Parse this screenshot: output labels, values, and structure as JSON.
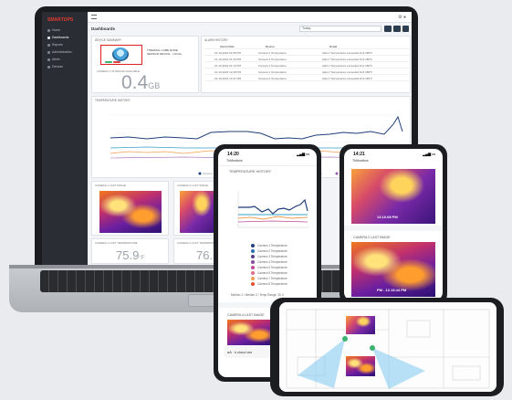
{
  "dashboard": {
    "logo": "SMARTOPS",
    "page_title": "Dashboards",
    "nav_items": [
      "Home",
      "Dashboards",
      "Reports",
      "Administration",
      "Alerts",
      "Devices"
    ],
    "date_range": "Today",
    "device_panel_title": "DEVICE SUMMARY",
    "device_name": "THERMAL CUBE NODE",
    "device_subtitle": "SENSOR DEVICE · LOCAL",
    "storage_label": "CAMERA 1 STORAGE AVAILABLE",
    "storage_value": "0.4",
    "storage_unit": "GB",
    "alarm_panel_title": "ALARM HISTORY",
    "alarm_headers": [
      "Alarm Date",
      "Device",
      "Detail"
    ],
    "alarm_rows": [
      [
        "21-10-2022 01:55 PM",
        "Camera 1 Temperature",
        "Alarm! Temperature exceeded limit 180°F"
      ],
      [
        "21-10-2022 01:34 PM",
        "Camera 2 Temperature",
        "Alarm! Temperature exceeded limit 180°F"
      ],
      [
        "21-10-2022 01:12 PM",
        "Camera 1 Temperature",
        "Alarm! Temperature exceeded limit 180°F"
      ],
      [
        "21-10-2022 12:48 PM",
        "Camera 1 Temperature",
        "Alarm! Temperature exceeded limit 180°F"
      ],
      [
        "21-10-2022 12:21 PM",
        "Camera 2 Temperature",
        "Alarm! Temperature exceeded limit 180°F"
      ]
    ],
    "temp_history_title": "TEMPERATURE HISTORY",
    "temp_legend": [
      "Camera 1 Temperature",
      "Camera 2 Temperature",
      "Camera 3 Temperature",
      "Camera 4 Temperature"
    ],
    "cam1_title": "CAMERA 1 LAST IMAGE",
    "cam2_title": "CAMERA 2 LAST IMAGE",
    "cam1_temp_title": "CAMERA 1 LAST TEMPERATURE",
    "cam2_temp_title": "CAMERA 2 LAST TEMPERATURE",
    "cam1_temp": "75.9",
    "cam1_temp_unit": "°F",
    "cam2_temp": "76."
  },
  "phone1": {
    "time": "14:20",
    "subtitle": "ThMonitors",
    "section": "TEMPERATURE HISTORY",
    "legend": [
      {
        "label": "Camera 1 Temperature",
        "color": "#1f3f7a"
      },
      {
        "label": "Camera 2 Temperature",
        "color": "#2a6fb0"
      },
      {
        "label": "Camera 3 Temperature",
        "color": "#5b3f8c"
      },
      {
        "label": "Camera 4 Temperature",
        "color": "#8a4aa0"
      },
      {
        "label": "Camera 5 Temperature",
        "color": "#c04a9a"
      },
      {
        "label": "Camera 6 Temperature",
        "color": "#e0708a"
      },
      {
        "label": "Camera 7 Temperature",
        "color": "#f0a050"
      },
      {
        "label": "Camera 8 Temperature",
        "color": "#e05030"
      }
    ],
    "range_label": "Median 1 / Median 2 / Temp Range: 30 d",
    "cam_section": "CAMERA 4 LAST IMAGE",
    "nav_back": "aA",
    "nav_label": "ś cloud.mo"
  },
  "phone2": {
    "time": "14:21",
    "subtitle": "ThMonitors",
    "img1_caption": "13.10.08 PM",
    "cam_section": "CAMERA 2 LAST IMAGE",
    "img2_caption": "PM - 12.15.44 PM"
  },
  "colors": {
    "accent_red": "#e02020",
    "sidebar_bg": "#2a2d33",
    "series_blue": "#1f3f7a",
    "series_orange": "#f0a050",
    "series_cyan": "#3aa0c8"
  }
}
